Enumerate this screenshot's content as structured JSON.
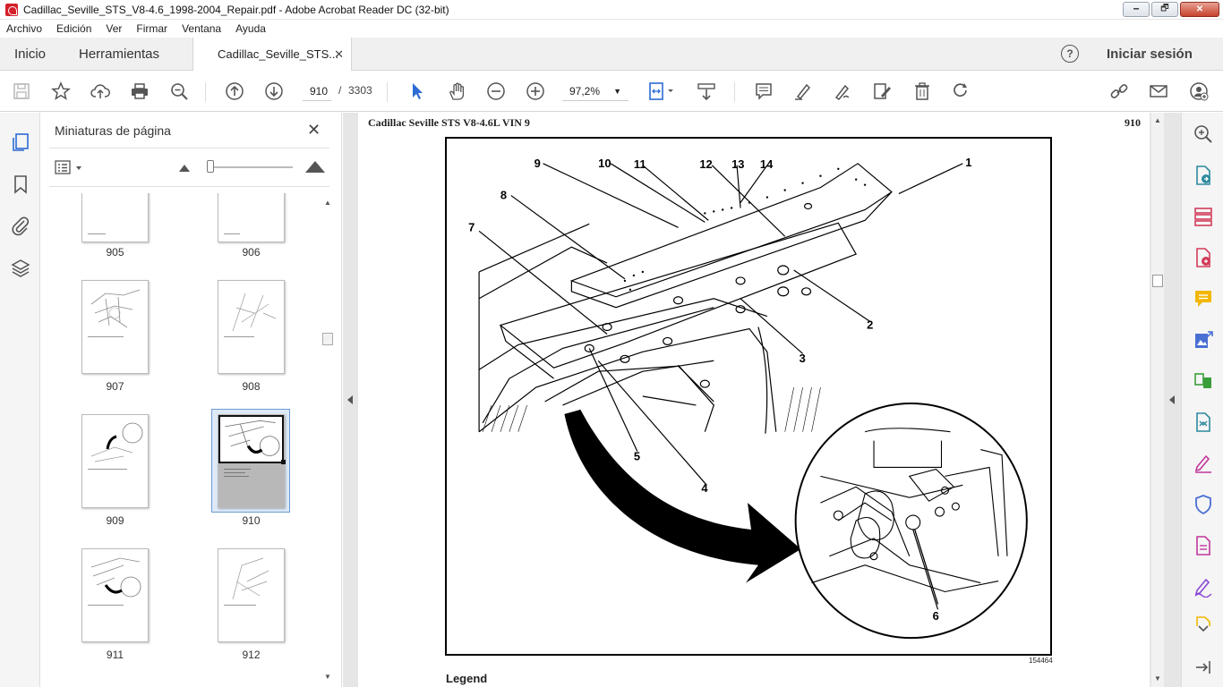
{
  "window": {
    "title": "Cadillac_Seville_STS_V8-4.6_1998-2004_Repair.pdf - Adobe Acrobat Reader DC (32-bit)",
    "minimize": "🗕",
    "restore": "🗗",
    "close": "✕"
  },
  "menu": [
    "Archivo",
    "Edición",
    "Ver",
    "Firmar",
    "Ventana",
    "Ayuda"
  ],
  "tabs": {
    "home": "Inicio",
    "tools": "Herramientas",
    "document": "Cadillac_Seville_STS...",
    "document_close": "✕",
    "help": "?",
    "signin": "Iniciar sesión"
  },
  "toolbar": {
    "current_page": "910",
    "page_separator": "/",
    "total_pages": "3303",
    "zoom": "97,2%",
    "zoom_caret": "▼"
  },
  "thumbnails_panel": {
    "title": "Miniaturas de página",
    "close": "✕",
    "pages": [
      {
        "label": "905",
        "selected": false
      },
      {
        "label": "906",
        "selected": false
      },
      {
        "label": "907",
        "selected": false
      },
      {
        "label": "908",
        "selected": false
      },
      {
        "label": "909",
        "selected": false
      },
      {
        "label": "910",
        "selected": true
      },
      {
        "label": "911",
        "selected": false
      },
      {
        "label": "912",
        "selected": false
      }
    ]
  },
  "document": {
    "header": "Cadillac Seville STS V8-4.6L VIN 9",
    "page_number": "910",
    "figure_id": "154464",
    "legend": "Legend",
    "callouts": [
      "1",
      "2",
      "3",
      "4",
      "5",
      "6",
      "7",
      "8",
      "9",
      "10",
      "11",
      "12",
      "13",
      "14"
    ]
  },
  "colors": {
    "accent": "#2d6bd4",
    "selection": "#dde9f7",
    "close_red": "#c7432d",
    "icon_gray": "#666666"
  }
}
